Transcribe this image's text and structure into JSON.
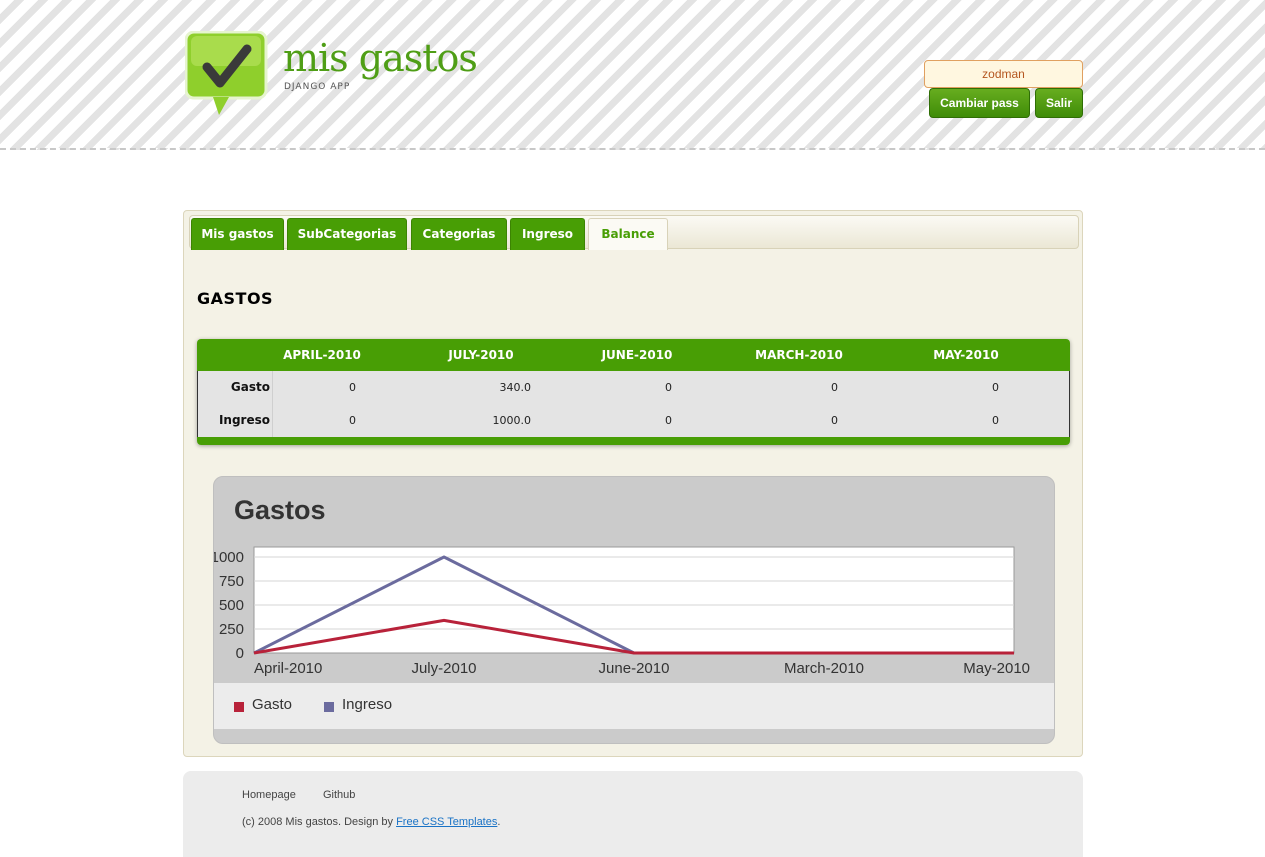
{
  "header": {
    "logo_title": "mis gastos",
    "logo_subtitle": "DJANGO APP",
    "username": "zodman",
    "change_pass_label": "Cambiar pass",
    "logout_label": "Salir"
  },
  "tabs": [
    {
      "label": "Mis gastos",
      "active": false
    },
    {
      "label": "SubCategorias",
      "active": false
    },
    {
      "label": "Categorias",
      "active": false
    },
    {
      "label": "Ingreso",
      "active": false
    },
    {
      "label": "Balance",
      "active": true
    }
  ],
  "section_title": "GASTOS",
  "table": {
    "columns": [
      "APRIL-2010",
      "JULY-2010",
      "JUNE-2010",
      "MARCH-2010",
      "MAY-2010"
    ],
    "rows": [
      {
        "label": "Gasto",
        "values": [
          "0",
          "340.0",
          "0",
          "0",
          "0"
        ]
      },
      {
        "label": "Ingreso",
        "values": [
          "0",
          "1000.0",
          "0",
          "0",
          "0"
        ]
      }
    ]
  },
  "chart_data": {
    "type": "line",
    "title": "Gastos",
    "categories": [
      "April-2010",
      "July-2010",
      "June-2010",
      "March-2010",
      "May-2010"
    ],
    "series": [
      {
        "name": "Gasto",
        "values": [
          0,
          340,
          0,
          0,
          0
        ],
        "color": "#b8223a"
      },
      {
        "name": "Ingreso",
        "values": [
          0,
          1000,
          0,
          0,
          0
        ],
        "color": "#6b6b9e"
      }
    ],
    "y_ticks": [
      0,
      250,
      500,
      750,
      1000
    ],
    "ylim": [
      0,
      1000
    ],
    "grid": true,
    "legend_position": "bottom"
  },
  "footer": {
    "links": [
      "Homepage",
      "Github"
    ],
    "copyright_prefix": "(c) 2008 Mis gastos. Design by ",
    "copyright_link": "Free CSS Templates",
    "copyright_suffix": "."
  },
  "colors": {
    "brand_green": "#489e05",
    "logo_green": "#4f9e16",
    "user_text": "#b4561f"
  }
}
